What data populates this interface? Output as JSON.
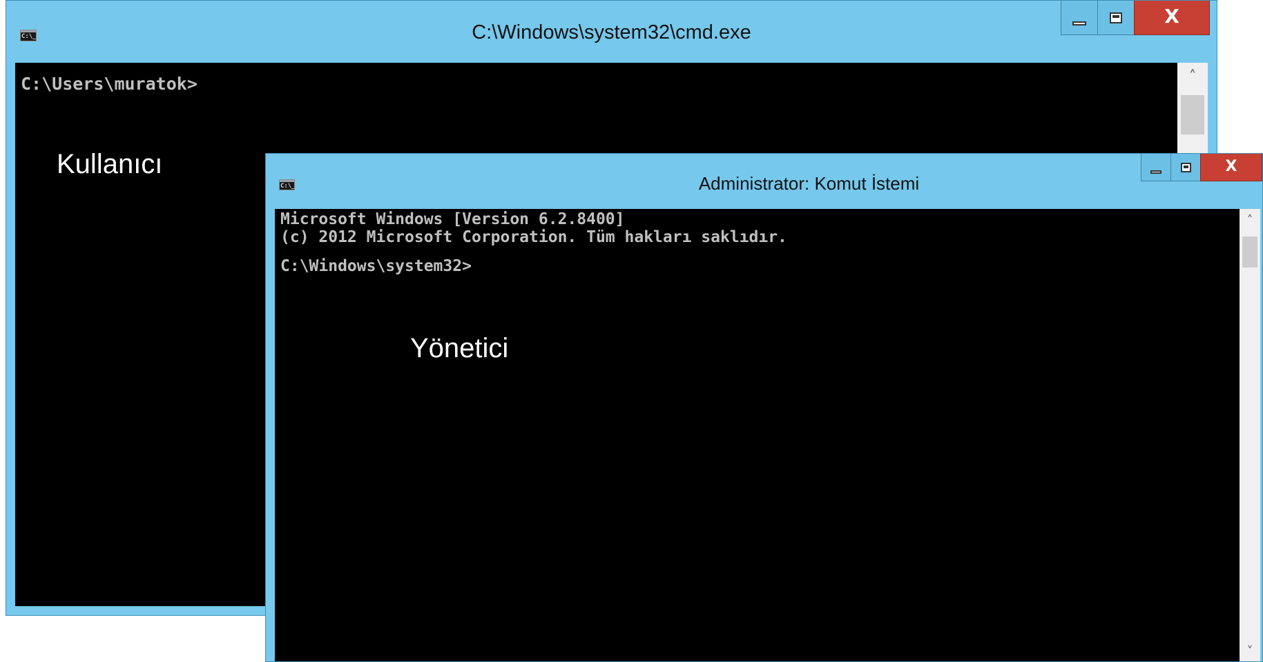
{
  "windows": {
    "user": {
      "title": "C:\\Windows\\system32\\cmd.exe",
      "icon_text": "C:\\_",
      "console_lines": [
        "C:\\Users\\muratok>"
      ],
      "label": "Kullanıcı",
      "close_glyph": "X"
    },
    "admin": {
      "title": "Administrator: Komut İstemi",
      "icon_text": "C:\\_",
      "console_lines": [
        "Microsoft Windows [Version 6.2.8400]",
        "(c) 2012 Microsoft Corporation. Tüm hakları saklıdır.",
        "",
        "C:\\Windows\\system32>"
      ],
      "label": "Yönetici",
      "close_glyph": "X"
    }
  },
  "colors": {
    "frame": "#76c8ec",
    "console_bg": "#000000",
    "console_text": "#c0c0c0",
    "close_button": "#c74033"
  }
}
